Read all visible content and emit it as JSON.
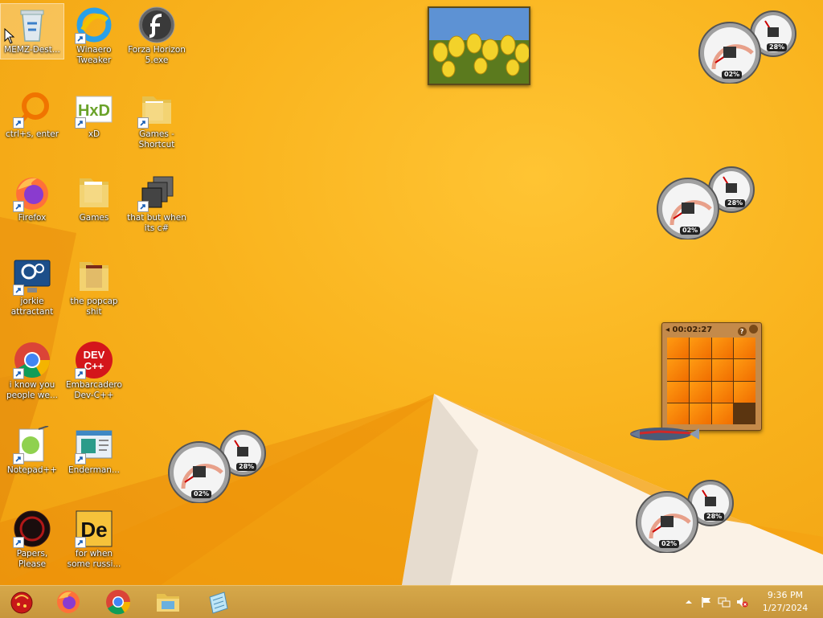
{
  "desktop": {
    "icons": [
      {
        "label": "MEMZ-Dest...",
        "icon": "recycle-bin-icon"
      },
      {
        "label": "Winaero Tweaker",
        "icon": "winaero-tweaker-icon"
      },
      {
        "label": "Forza Horizon 5.exe",
        "icon": "flash-icon"
      },
      {
        "label": "ctrl+s, enter",
        "icon": "orange-search-icon"
      },
      {
        "label": "xD",
        "icon": "hxd-icon"
      },
      {
        "label": "Games - Shortcut",
        "icon": "folder-icon"
      },
      {
        "label": "Firefox",
        "icon": "firefox-icon"
      },
      {
        "label": "Games",
        "icon": "folder-icon"
      },
      {
        "label": "that but when its c#",
        "icon": "stacked-windows-icon"
      },
      {
        "label": "jorkie attractant",
        "icon": "gear-monitor-icon"
      },
      {
        "label": "the popcap shit",
        "icon": "folder-icon"
      },
      {
        "label": "i know you people we...",
        "icon": "chrome-icon"
      },
      {
        "label": "Embarcadero Dev-C++",
        "icon": "devcpp-icon"
      },
      {
        "label": "Notepad++",
        "icon": "notepadpp-icon"
      },
      {
        "label": "Enderman...",
        "icon": "window-app-icon"
      },
      {
        "label": "Papers, Please",
        "icon": "papers-please-icon"
      },
      {
        "label": "for when some russi...",
        "icon": "de-icon"
      }
    ],
    "devcpp_icon_text": [
      "DEV",
      "C++"
    ],
    "de_icon_text": "De",
    "hxd_icon_text": "HxD"
  },
  "gadgets": {
    "meters": [
      {
        "cpu": "02%",
        "ram": "28%"
      },
      {
        "cpu": "02%",
        "ram": "28%"
      },
      {
        "cpu": "02%",
        "ram": "28%"
      },
      {
        "cpu": "02%",
        "ram": "28%"
      }
    ],
    "puzzle": {
      "timer": "00:02:27",
      "help": "?"
    }
  },
  "taskbar": {
    "pinned": [
      "start-orb-icon",
      "firefox-icon",
      "chrome-icon",
      "file-explorer-icon",
      "notepad-icon"
    ],
    "clock": {
      "time": "9:36 PM",
      "date": "1/27/2024"
    }
  },
  "colors": {
    "accent": "#f7b21c",
    "taskbar": "#c9993f"
  }
}
